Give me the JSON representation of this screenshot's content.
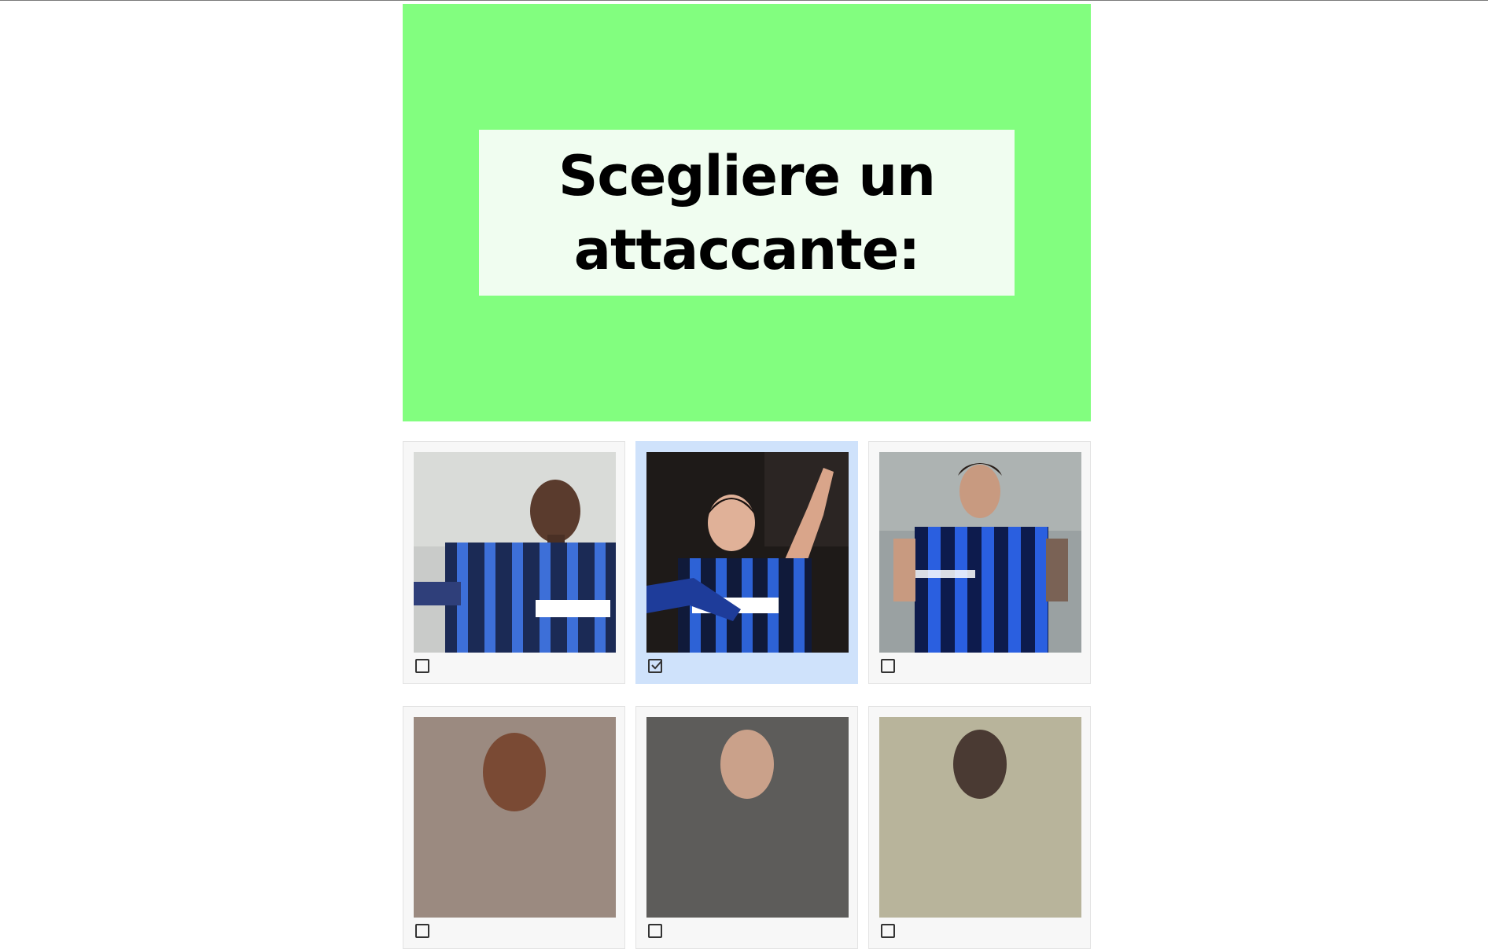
{
  "question": {
    "text": "Scegliere un attaccante:"
  },
  "colors": {
    "banner_background": "#82fe7f",
    "question_box_background": "#f0fdf0",
    "selected_card_background": "#cfe2fb",
    "card_background": "#f7f7f7"
  },
  "options": [
    {
      "image_icon": "player-photo-icon",
      "checked": false
    },
    {
      "image_icon": "player-photo-icon",
      "checked": true
    },
    {
      "image_icon": "player-photo-icon",
      "checked": false
    },
    {
      "image_icon": "player-photo-icon",
      "checked": false
    },
    {
      "image_icon": "player-photo-icon",
      "checked": false
    },
    {
      "image_icon": "player-photo-icon",
      "checked": false
    }
  ]
}
